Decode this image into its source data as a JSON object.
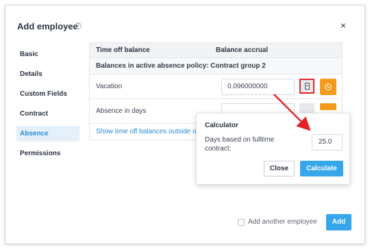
{
  "modal": {
    "title": "Add employee",
    "help_glyph": "?",
    "close_glyph": "×"
  },
  "sidebar": {
    "items": [
      {
        "label": "Basic",
        "active": false
      },
      {
        "label": "Details",
        "active": false
      },
      {
        "label": "Custom Fields",
        "active": false
      },
      {
        "label": "Contract",
        "active": false
      },
      {
        "label": "Absence",
        "active": true
      },
      {
        "label": "Permissions",
        "active": false
      }
    ]
  },
  "table": {
    "headers": [
      "Time off balance",
      "Balance accrual"
    ],
    "group_label": "Balances in active absence policy: Contract group 2",
    "rows": [
      {
        "label": "Vacation",
        "value": "0.096000000"
      },
      {
        "label": "Absence in days",
        "value": ""
      }
    ],
    "link_label": "Show time off balances outside of current absence policy"
  },
  "calculator": {
    "title": "Calculator",
    "field_label": "Days based on fulltime contract:",
    "field_value": "25.0",
    "close_label": "Close",
    "calculate_label": "Calculate"
  },
  "footer": {
    "checkbox_label": "Add another employee",
    "add_label": "Add"
  },
  "icons": {
    "calculator_button": "calculator-icon",
    "accrual_button": "clock-icon",
    "annotation": "red-arrow-annotation"
  },
  "colors": {
    "accent": "#36a7ea",
    "orange": "#f39a1c",
    "highlight": "#e0252a",
    "active_nav_bg": "#e4f1fb"
  }
}
